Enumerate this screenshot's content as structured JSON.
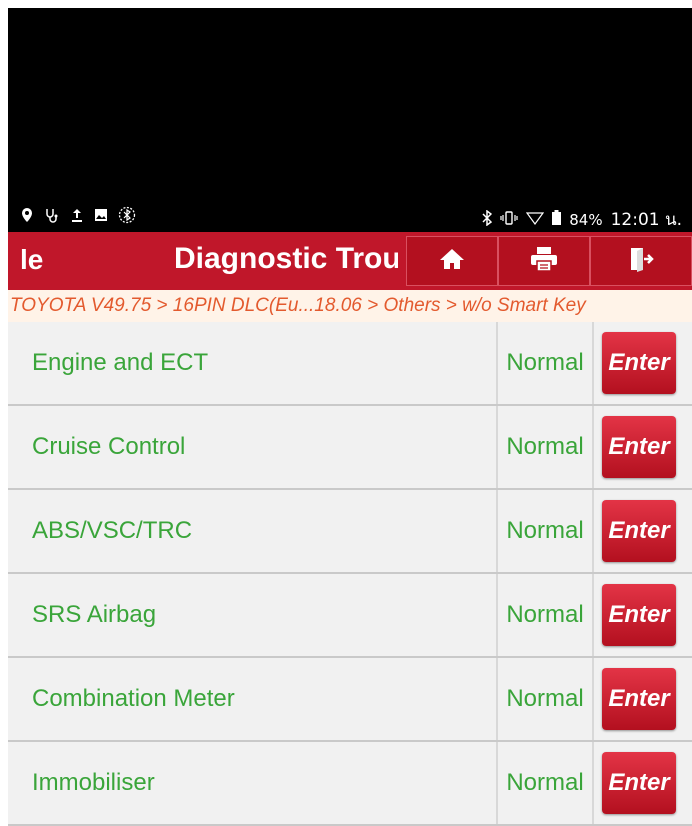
{
  "statusbar": {
    "left_icons": [
      "map-pin-icon",
      "stethoscope-icon",
      "upload-icon",
      "image-icon",
      "bluetooth-circle-icon"
    ],
    "right_icons": [
      "bluetooth-icon",
      "vibrate-icon",
      "wifi-icon",
      "battery-icon"
    ],
    "battery": "84%",
    "time": "12:01 น."
  },
  "titlebar": {
    "left_fragment": "le",
    "title": "Diagnostic Trouble Code",
    "buttons": [
      "home-icon",
      "print-icon",
      "exit-icon"
    ]
  },
  "breadcrumb": "TOYOTA V49.75 > 16PIN DLC(Eu...18.06 > Others > w/o Smart Key",
  "systems": [
    {
      "name": "Engine and ECT",
      "status": "Normal",
      "action": "Enter"
    },
    {
      "name": "Cruise Control",
      "status": "Normal",
      "action": "Enter"
    },
    {
      "name": "ABS/VSC/TRC",
      "status": "Normal",
      "action": "Enter"
    },
    {
      "name": "SRS Airbag",
      "status": "Normal",
      "action": "Enter"
    },
    {
      "name": "Combination Meter",
      "status": "Normal",
      "action": "Enter"
    },
    {
      "name": "Immobiliser",
      "status": "Normal",
      "action": "Enter"
    }
  ],
  "colors": {
    "header_red": "#c0172a",
    "text_green": "#3aa53a",
    "breadcrumb_orange": "#e35a2e",
    "breadcrumb_bg": "#fff3e8",
    "row_bg": "#f1f1f1"
  }
}
